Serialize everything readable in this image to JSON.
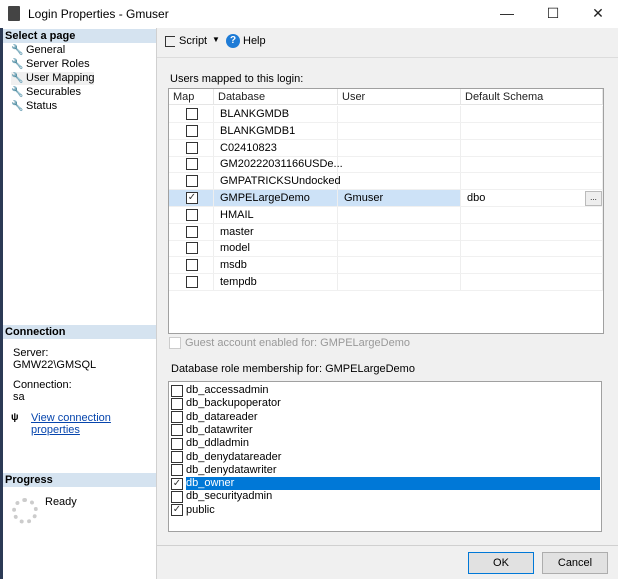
{
  "window": {
    "title": "Login Properties - Gmuser",
    "min": "—",
    "max": "☐",
    "close": "✕"
  },
  "left": {
    "select_header": "Select a page",
    "pages": [
      {
        "label": "General"
      },
      {
        "label": "Server Roles"
      },
      {
        "label": "User Mapping"
      },
      {
        "label": "Securables"
      },
      {
        "label": "Status"
      }
    ],
    "connection_header": "Connection",
    "server_label": "Server:",
    "server_value": "GMW22\\GMSQL",
    "connection_label": "Connection:",
    "connection_value": "sa",
    "view_link": "View connection properties",
    "progress_header": "Progress",
    "progress_status": "Ready"
  },
  "toolbar": {
    "script": "Script",
    "help": "Help"
  },
  "users": {
    "label": "Users mapped to this login:",
    "columns": [
      "Map",
      "Database",
      "User",
      "Default Schema"
    ],
    "rows": [
      {
        "map": false,
        "db": "BLANKGMDB",
        "user": "",
        "schema": ""
      },
      {
        "map": false,
        "db": "BLANKGMDB1",
        "user": "",
        "schema": ""
      },
      {
        "map": false,
        "db": "C02410823",
        "user": "",
        "schema": ""
      },
      {
        "map": false,
        "db": "GM20222031166USDe...",
        "user": "",
        "schema": ""
      },
      {
        "map": false,
        "db": "GMPATRICKSUndocked",
        "user": "",
        "schema": ""
      },
      {
        "map": true,
        "db": "GMPELargeDemo",
        "user": "Gmuser",
        "schema": "dbo",
        "selected": true
      },
      {
        "map": false,
        "db": "HMAIL",
        "user": "",
        "schema": ""
      },
      {
        "map": false,
        "db": "master",
        "user": "",
        "schema": ""
      },
      {
        "map": false,
        "db": "model",
        "user": "",
        "schema": ""
      },
      {
        "map": false,
        "db": "msdb",
        "user": "",
        "schema": ""
      },
      {
        "map": false,
        "db": "tempdb",
        "user": "",
        "schema": ""
      }
    ],
    "ellipsis": "..."
  },
  "guest": {
    "label": "Guest account enabled for: GMPELargeDemo",
    "checked": false
  },
  "roles": {
    "label": "Database role membership for: GMPELargeDemo",
    "items": [
      {
        "name": "db_accessadmin",
        "checked": false
      },
      {
        "name": "db_backupoperator",
        "checked": false
      },
      {
        "name": "db_datareader",
        "checked": false
      },
      {
        "name": "db_datawriter",
        "checked": false
      },
      {
        "name": "db_ddladmin",
        "checked": false
      },
      {
        "name": "db_denydatareader",
        "checked": false
      },
      {
        "name": "db_denydatawriter",
        "checked": false
      },
      {
        "name": "db_owner",
        "checked": true,
        "selected": true
      },
      {
        "name": "db_securityadmin",
        "checked": false
      },
      {
        "name": "public",
        "checked": true
      }
    ]
  },
  "buttons": {
    "ok": "OK",
    "cancel": "Cancel"
  }
}
